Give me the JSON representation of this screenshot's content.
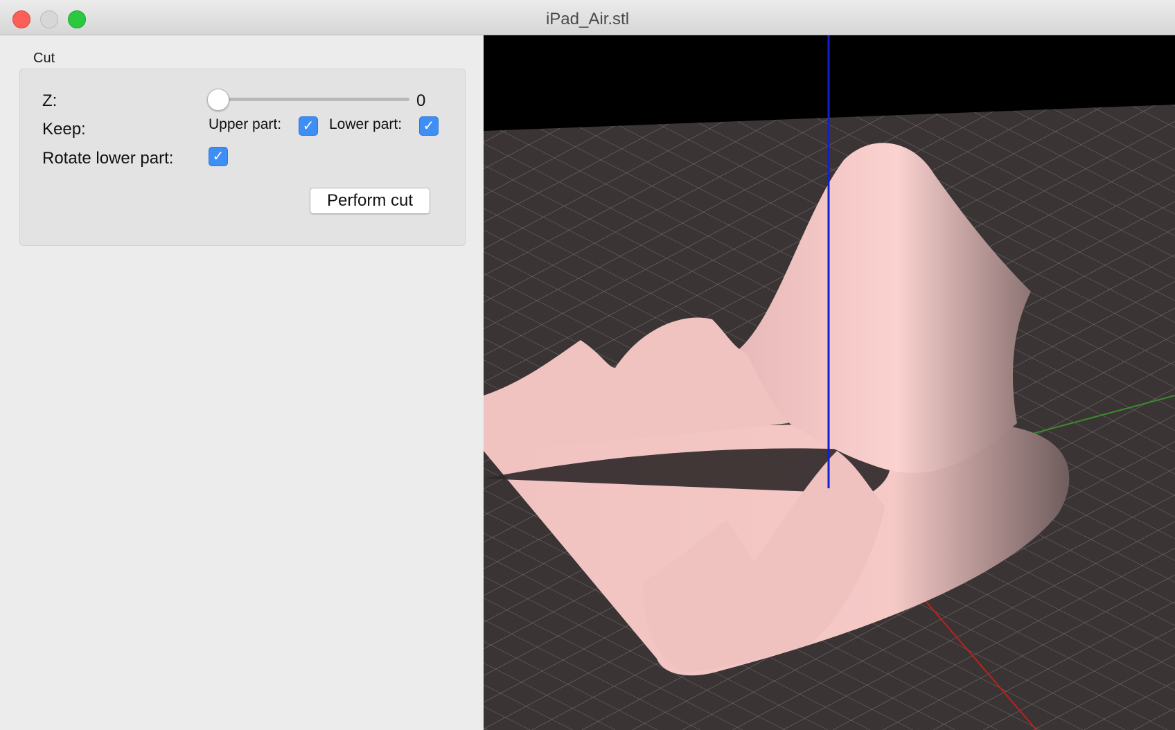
{
  "window": {
    "title": "iPad_Air.stl"
  },
  "cut_panel": {
    "group_title": "Cut",
    "z_label": "Z:",
    "z_value": "0",
    "z_slider_fraction": 0,
    "keep_label": "Keep:",
    "upper_part_label": "Upper part:",
    "upper_part_checked": true,
    "lower_part_label": "Lower part:",
    "lower_part_checked": true,
    "rotate_lower_label": "Rotate lower part:",
    "rotate_lower_checked": true,
    "perform_cut_label": "Perform cut"
  },
  "viewport": {
    "background": "#000000",
    "bed_color": "#3a3435",
    "grid_color": "#8a8486",
    "model_color": "#f4c6c4",
    "axis_colors": {
      "x": "#c0201a",
      "y": "#3b8a2e",
      "z": "#1020d0"
    }
  },
  "icons": {
    "checkmark": "✓"
  }
}
